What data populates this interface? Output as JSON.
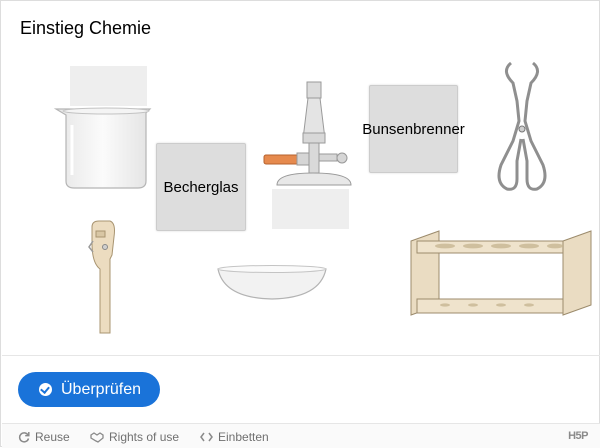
{
  "app": {
    "title": "Einstieg Chemie"
  },
  "draggables": [
    {
      "label": "Becherglas"
    },
    {
      "label": "Bunsenbrenner"
    }
  ],
  "images": [
    {
      "name": "beaker"
    },
    {
      "name": "bunsen-burner"
    },
    {
      "name": "crucible-tongs"
    },
    {
      "name": "test-tube-holder"
    },
    {
      "name": "evaporating-dish"
    },
    {
      "name": "test-tube-rack"
    }
  ],
  "actions": {
    "check_label": "Überprüfen"
  },
  "footer": {
    "reuse_label": "Reuse",
    "rights_label": "Rights of use",
    "embed_label": "Einbetten",
    "brand_label": "H5P"
  },
  "colors": {
    "accent": "#1a73d9",
    "dropzone": "#eeeeee",
    "draggable": "#dddddd"
  }
}
